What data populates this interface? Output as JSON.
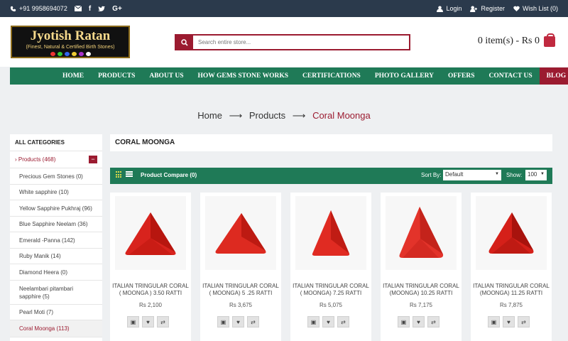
{
  "topbar": {
    "phone": "+91 9958694072",
    "social": [
      "mail-icon",
      "facebook-icon",
      "twitter-icon",
      "google-plus-icon"
    ],
    "login": "Login",
    "register": "Register",
    "wishlist": "Wish List (0)"
  },
  "header": {
    "logo_brand": "Jyotish Ratan",
    "logo_tagline": "(Finest, Natural & Certified Birth Stones)",
    "search_placeholder": "Search entire store...",
    "cart": "0 item(s) - Rs 0"
  },
  "nav": {
    "items": [
      "HOME",
      "PRODUCTS",
      "ABOUT US",
      "HOW GEMS STONE WORKS",
      "CERTIFICATIONS",
      "PHOTO GALLERY",
      "OFFERS",
      "CONTACT US",
      "BLOG"
    ]
  },
  "breadcrumb": {
    "home": "Home",
    "products": "Products",
    "current": "Coral Moonga",
    "separator": "⟶"
  },
  "sidebar": {
    "title": "ALL CATEGORIES",
    "root": "Products (468)",
    "collapse": "−",
    "categories": [
      "Precious Gem Stones (0)",
      "White sapphire (10)",
      "Yellow Sapphire Pukhraj (96)",
      "Blue Sapphire Neelam (36)",
      "Emerald -Panna (142)",
      "Ruby Manik (14)",
      "Diamond Heera (0)",
      "Neelambari pitambari sapphire (5)",
      "Pearl Moti (7)",
      "Coral Moonga (113)"
    ]
  },
  "content": {
    "category_title": "CORAL MOONGA",
    "compare": "Product Compare (0)",
    "sort_label": "Sort By:",
    "sort_value": "Default",
    "show_label": "Show:",
    "show_value": "100"
  },
  "products": [
    {
      "name": "ITALIAN TRINGULAR CORAL ( MOONGA ) 3.50 RATTI",
      "price": "Rs 2,100"
    },
    {
      "name": "ITALIAN TRINGULAR CORAL ( MOONGA) 5 .25 RATTI",
      "price": "Rs 3,675"
    },
    {
      "name": "ITALIAN TRINGULAR CORAL ( MOONGA) 7.25 RATTI",
      "price": "Rs 5,075"
    },
    {
      "name": "ITALIAN TRINGULAR CORAL (MOONGA) 10.25 RATTI",
      "price": "Rs 7,175"
    },
    {
      "name": "ITALIAN TRINGULAR CORAL (MOONGA) 11.25 RATTI",
      "price": "Rs 7,875"
    }
  ],
  "colors": {
    "topbar": "#2b3a4c",
    "accent": "#9b1b30",
    "nav": "#1f7a57",
    "coral": "#d8231d"
  }
}
